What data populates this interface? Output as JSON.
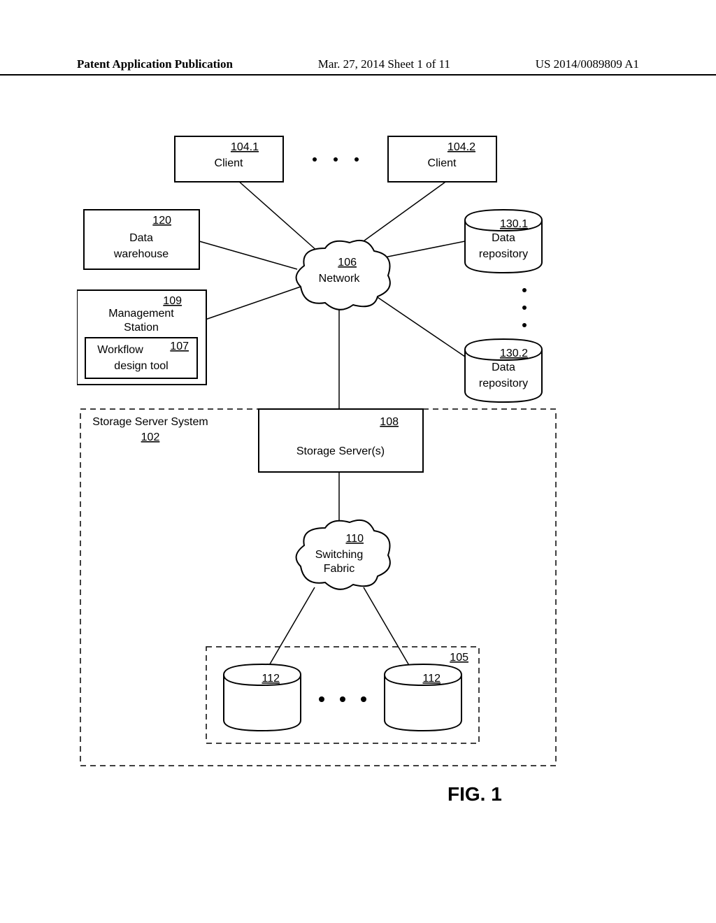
{
  "header": {
    "left": "Patent Application Publication",
    "mid": "Mar. 27, 2014  Sheet 1 of 11",
    "right": "US 2014/0089809 A1"
  },
  "fig": {
    "caption": "FIG. 1"
  },
  "nodes": {
    "client1": {
      "num": "104.1",
      "label": "Client"
    },
    "client2": {
      "num": "104.2",
      "label": "Client"
    },
    "dw": {
      "num": "120",
      "label1": "Data",
      "label2": "warehouse"
    },
    "mgmt": {
      "num": "109",
      "label1": "Management",
      "label2": "Station"
    },
    "wf": {
      "num": "107",
      "label1": "Workflow",
      "label2": "design tool"
    },
    "net": {
      "num": "106",
      "label": "Network"
    },
    "repo1": {
      "num": "130.1",
      "label1": "Data",
      "label2": "repository"
    },
    "repo2": {
      "num": "130.2",
      "label1": "Data",
      "label2": "repository"
    },
    "sss": {
      "num": "102",
      "label": "Storage Server System"
    },
    "srv": {
      "num": "108",
      "label": "Storage Server(s)"
    },
    "sf": {
      "num": "110",
      "label1": "Switching",
      "label2": "Fabric"
    },
    "disks": {
      "num": "105"
    },
    "disk": {
      "num": "112"
    }
  },
  "chart_data": {
    "type": "diagram",
    "title": "FIG. 1",
    "nodes": [
      {
        "id": "104.1",
        "label": "Client",
        "shape": "box"
      },
      {
        "id": "104.2",
        "label": "Client",
        "shape": "box"
      },
      {
        "id": "120",
        "label": "Data warehouse",
        "shape": "box"
      },
      {
        "id": "109",
        "label": "Management Station",
        "shape": "box",
        "contains": [
          "107"
        ]
      },
      {
        "id": "107",
        "label": "Workflow design tool",
        "shape": "box"
      },
      {
        "id": "106",
        "label": "Network",
        "shape": "cloud"
      },
      {
        "id": "130.1",
        "label": "Data repository",
        "shape": "cylinder"
      },
      {
        "id": "130.2",
        "label": "Data repository",
        "shape": "cylinder"
      },
      {
        "id": "102",
        "label": "Storage Server System",
        "shape": "dashed-box",
        "contains": [
          "108",
          "110",
          "105"
        ]
      },
      {
        "id": "108",
        "label": "Storage Server(s)",
        "shape": "box"
      },
      {
        "id": "110",
        "label": "Switching Fabric",
        "shape": "cloud"
      },
      {
        "id": "105",
        "label": "",
        "shape": "dashed-box",
        "contains": [
          "112",
          "112"
        ]
      },
      {
        "id": "112",
        "label": "",
        "shape": "cylinder"
      }
    ],
    "edges": [
      [
        "104.1",
        "106"
      ],
      [
        "104.2",
        "106"
      ],
      [
        "120",
        "106"
      ],
      [
        "109",
        "106"
      ],
      [
        "130.1",
        "106"
      ],
      [
        "130.2",
        "106"
      ],
      [
        "106",
        "108"
      ],
      [
        "108",
        "110"
      ],
      [
        "110",
        "112"
      ],
      [
        "110",
        "112"
      ]
    ],
    "ellipsis": [
      {
        "between": [
          "104.1",
          "104.2"
        ]
      },
      {
        "between": [
          "130.1",
          "130.2"
        ]
      },
      {
        "between": [
          "112",
          "112"
        ]
      }
    ]
  }
}
